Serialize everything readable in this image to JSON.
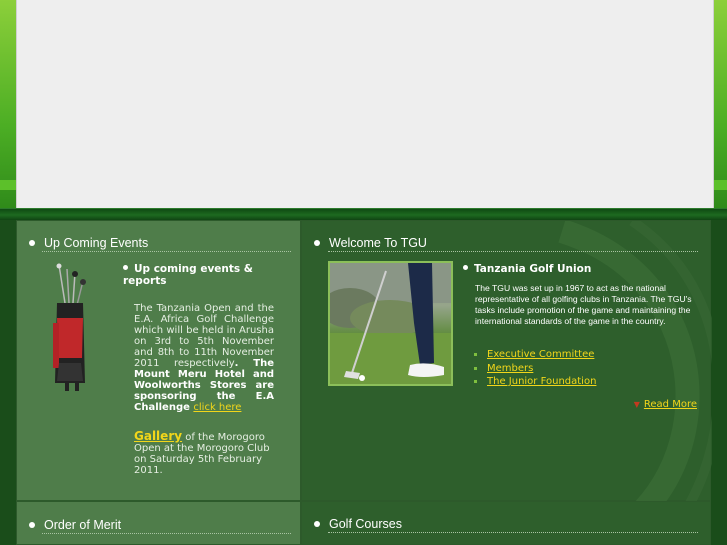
{
  "upcoming": {
    "title": "Up Coming Events",
    "heading": "Up coming events & reports",
    "text_plain": "The Tanzania Open and the E.A. Africa Golf Challenge which will be held in Arusha on 3rd to 5th November and 8th to 11th November 2011 respectively",
    "text_bold": ". The Mount Meru Hotel and Woolworths Stores are sponsoring the E.A Challenge ",
    "click_here": "click here",
    "gallery_link": "Gallery",
    "gallery_text": " of the Morogoro Open at the Morogoro Club on Saturday 5th February 2011."
  },
  "welcome": {
    "title": "Welcome To TGU",
    "heading": "Tanzania Golf Union",
    "text": "The TGU was set up in 1967 to act as the national representative of all golfing clubs in Tanzania. The TGU's tasks include promotion of the game and maintaining the international standards of the game in the country.",
    "links": [
      "Executive Committee",
      "Members",
      "The Junior Foundation"
    ],
    "read_more": "Read More"
  },
  "order_of_merit": {
    "title": "Order of Merit"
  },
  "golf_courses": {
    "title": "Golf Courses"
  },
  "icons": [
    "golf-bag-icon",
    "golfer-photo",
    "bullet-icon",
    "arrow-icon"
  ]
}
